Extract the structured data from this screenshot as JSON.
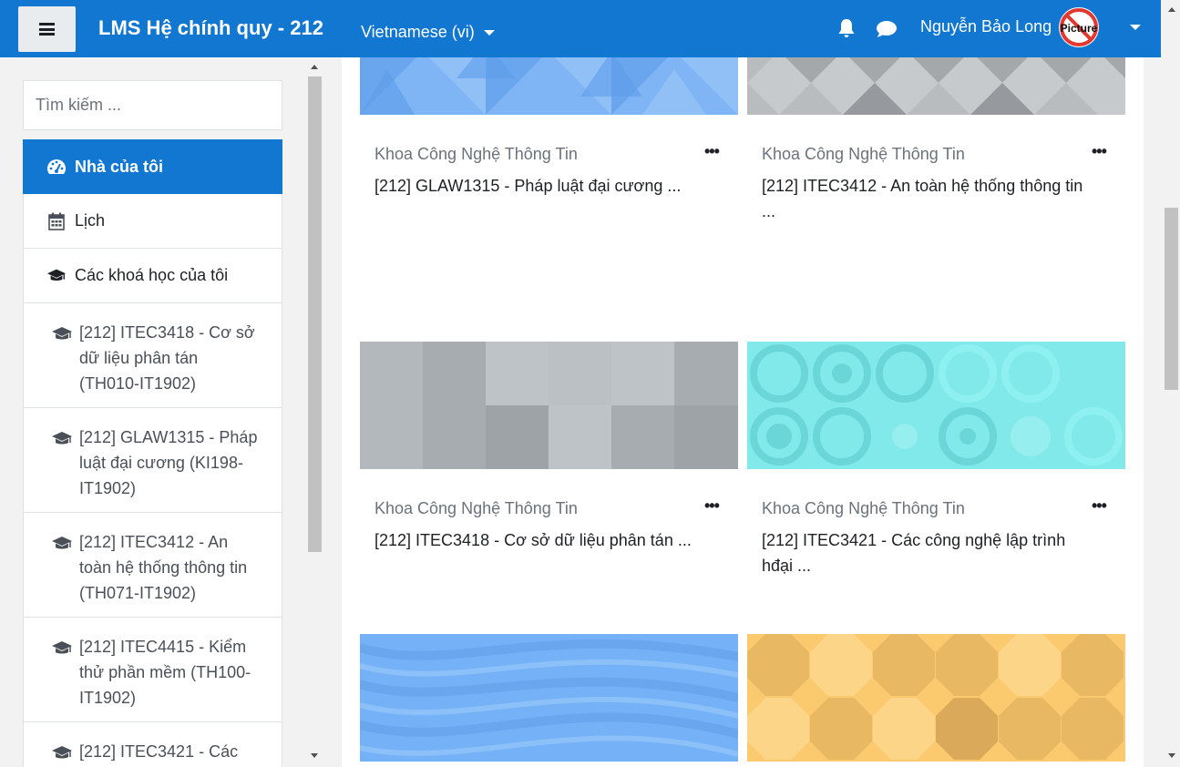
{
  "navbar": {
    "brand": "LMS Hệ chính quy - 212",
    "language": "Vietnamese (vi)",
    "user_name": "Nguyễn Bảo Long",
    "avatar_text": "Picture",
    "icons": [
      "menu-icon",
      "bell-icon",
      "chat-icon",
      "caret-down-icon"
    ],
    "accent_color": "#1177d1"
  },
  "sidebar": {
    "search_placeholder": "Tìm kiếm ...",
    "items": [
      {
        "label": "Nhà của tôi",
        "icon": "dashboard-icon",
        "active": true
      },
      {
        "label": "Lịch",
        "icon": "calendar-icon"
      },
      {
        "label": "Các khoá học của tôi",
        "icon": "graduation-cap-icon"
      }
    ],
    "courses": [
      {
        "label": "[212] ITEC3418 - Cơ sở dữ liệu phân tán (TH010-IT1902)",
        "icon": "graduation-cap-icon"
      },
      {
        "label": "[212] GLAW1315 - Pháp luật đại cương (KI198-IT1902)",
        "icon": "graduation-cap-icon"
      },
      {
        "label": "[212] ITEC3412 - An toàn hệ thống thông tin (TH071-IT1902)",
        "icon": "graduation-cap-icon"
      },
      {
        "label": "[212] ITEC4415 - Kiểm thử phần mềm (TH100-IT1902)",
        "icon": "graduation-cap-icon"
      },
      {
        "label": "[212] ITEC3421 - Các",
        "icon": "graduation-cap-icon"
      }
    ]
  },
  "courses": [
    {
      "category": "Khoa Công Nghệ Thông Tin",
      "name": "[212] GLAW1315 - Pháp luật đại cương ...",
      "menu": "•••",
      "pattern": "blue-triangles"
    },
    {
      "category": "Khoa Công Nghệ Thông Tin",
      "name": "[212] ITEC3412 - An toàn hệ thống thông tin ...",
      "menu": "•••",
      "pattern": "grey-diamonds"
    },
    {
      "category": "Khoa Công Nghệ Thông Tin",
      "name": "[212] ITEC3418 - Cơ sở dữ liệu phân tán ...",
      "menu": "•••",
      "pattern": "grey-squares"
    },
    {
      "category": "Khoa Công Nghệ Thông Tin",
      "name": "[212] ITEC3421 - Các công nghệ lập trình hđại ...",
      "menu": "•••",
      "pattern": "cyan-circles"
    },
    {
      "pattern": "blue-waves"
    },
    {
      "pattern": "yellow-octagons"
    }
  ]
}
